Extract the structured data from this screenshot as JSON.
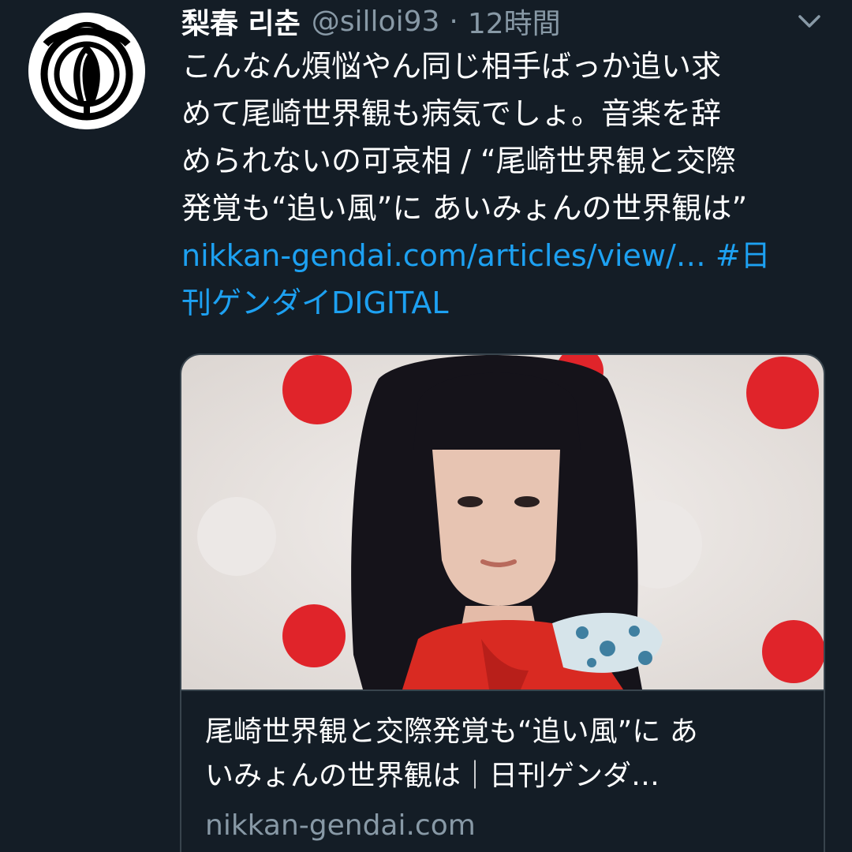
{
  "tweet": {
    "display_name": "梨春 리춘",
    "handle": "@silloi93",
    "separator": "·",
    "time": "12時間",
    "text_lines": [
      "こんなん煩悩やん同じ相手ばっか追い求",
      "めて尾崎世界観も病気でしょ。音楽を辞",
      "められないの可哀相 / “尾崎世界観と交際",
      "発覚も“追い風”に あいみょんの世界観は”"
    ],
    "link_line1": "nikkan-gendai.com/articles/view/… #日",
    "link_line2": "刊ゲンダイDIGITAL"
  },
  "card": {
    "title_lines": [
      "尾崎世界観と交際発覚も“追い風”に あ",
      "いみょんの世界観は｜日刊ゲンダ…"
    ],
    "domain": "nikkan-gendai.com"
  },
  "icons": {
    "avatar": "crest-logo-icon",
    "menu": "chevron-down-icon"
  },
  "colors": {
    "background": "#141d26",
    "text": "#ffffff",
    "secondary": "#8899a6",
    "link": "#1da1f2",
    "border": "#38444d"
  }
}
